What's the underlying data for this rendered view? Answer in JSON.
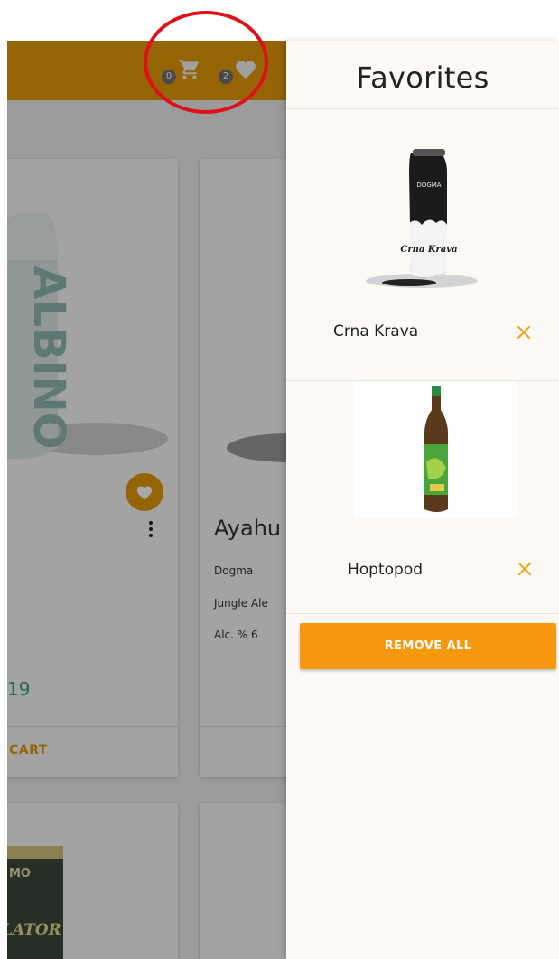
{
  "header": {
    "cart_count": "0",
    "favorites_count": "2"
  },
  "products": [
    {
      "price": "19",
      "cart_label": "CART",
      "can_text": "ALBINO"
    },
    {
      "name": "Ayahu",
      "brewery": "Dogma",
      "style": "Jungle Ale",
      "alcohol": "Alc. % 6"
    },
    {
      "can_text_top": "MO",
      "can_text_bottom": "LATOR"
    }
  ],
  "favorites": {
    "title": "Favorites",
    "items": [
      {
        "name": "Crna Krava",
        "label_text": "Crna Krava",
        "brand": "DOGMA"
      },
      {
        "name": "Hoptopod"
      }
    ],
    "remove_all_label": "REMOVE ALL"
  },
  "colors": {
    "accent": "#e39a08",
    "remove_button": "#f6990e",
    "price": "#2fa37a",
    "annotation": "#e0101a",
    "drawer_bg": "#fdfaf5"
  },
  "icons": {
    "cart": "cart-icon",
    "favorites": "heart-icon",
    "remove": "close-icon",
    "more": "more-vertical-icon"
  }
}
